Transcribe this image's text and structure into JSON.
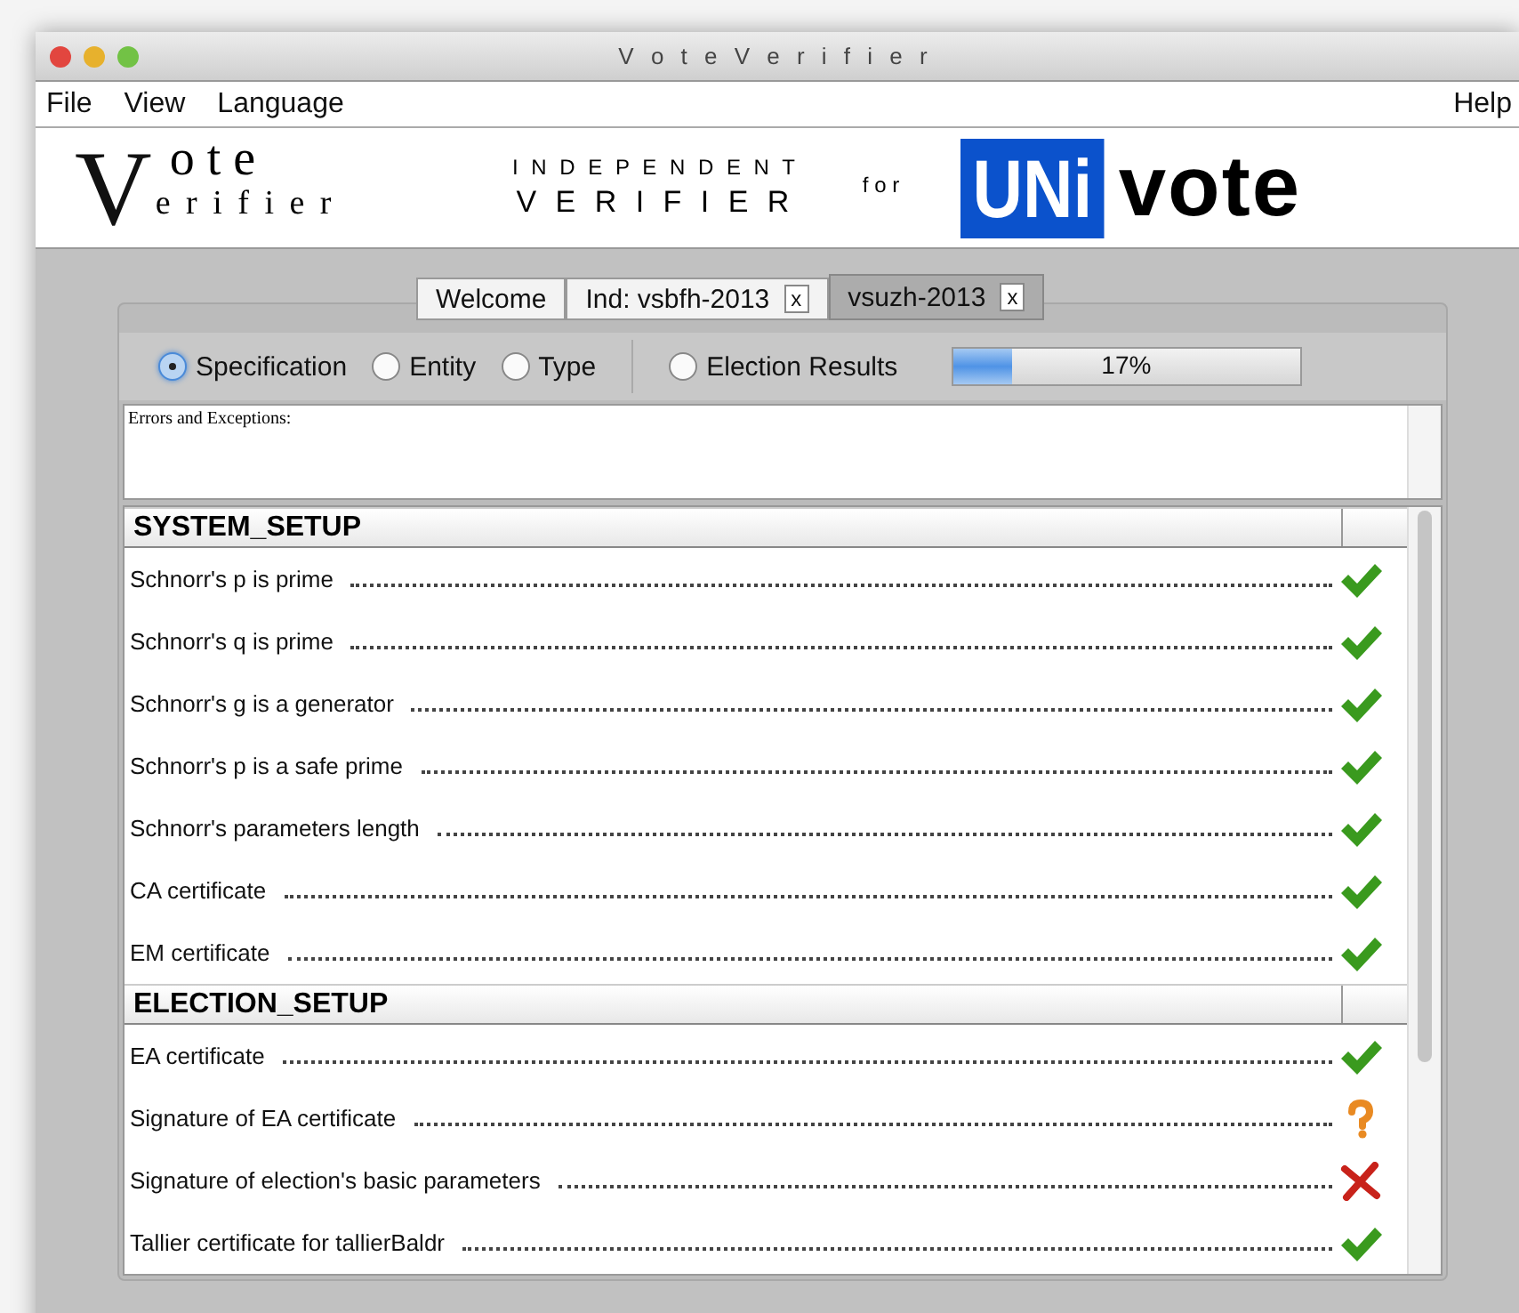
{
  "window": {
    "title": "V o t e V e r i f i e r"
  },
  "menu": {
    "left": [
      "File",
      "View",
      "Language"
    ],
    "right": "Help"
  },
  "banner": {
    "logo_initial": "V",
    "logo_top": "o t e",
    "logo_bottom": "e r i f i e r",
    "subtitle_top": "I N D E P E N D E N T",
    "subtitle_bottom": "V E R I F I E R",
    "for": "f o r",
    "brand_box": "UNi",
    "brand_rest": "vote"
  },
  "tabs": [
    {
      "label": "Welcome",
      "selected": false
    },
    {
      "label": "Ind: vsbfh-2013",
      "close": "x",
      "selected": false
    },
    {
      "label": "vsuzh-2013",
      "close": "x",
      "selected": true
    }
  ],
  "views": [
    {
      "label": "Specification",
      "selected": true
    },
    {
      "label": "Entity",
      "selected": false
    },
    {
      "label": "Type",
      "selected": false
    },
    {
      "label": "Election Results",
      "selected": false
    }
  ],
  "progress": {
    "level": 0.17,
    "reading": "17%"
  },
  "errors": {
    "label": "Errors and Exceptions:"
  },
  "sections": [
    {
      "title": "SYSTEM_SETUP",
      "checks": [
        {
          "name": "Schnorr's p is prime",
          "kind": "pass"
        },
        {
          "name": "Schnorr's q is prime",
          "kind": "pass"
        },
        {
          "name": "Schnorr's g is a generator",
          "kind": "pass"
        },
        {
          "name": "Schnorr's p is a safe prime",
          "kind": "pass"
        },
        {
          "name": "Schnorr's parameters length",
          "kind": "pass"
        },
        {
          "name": "CA certificate",
          "kind": "pass"
        },
        {
          "name": "EM certificate",
          "kind": "pass"
        }
      ]
    },
    {
      "title": "ELECTION_SETUP",
      "checks": [
        {
          "name": "EA certificate",
          "kind": "pass"
        },
        {
          "name": "Signature of EA certificate",
          "kind": "unknown"
        },
        {
          "name": "Signature of election's basic parameters",
          "kind": "fail"
        },
        {
          "name": "Tallier certificate for tallierBaldr",
          "kind": "pass"
        }
      ]
    }
  ]
}
